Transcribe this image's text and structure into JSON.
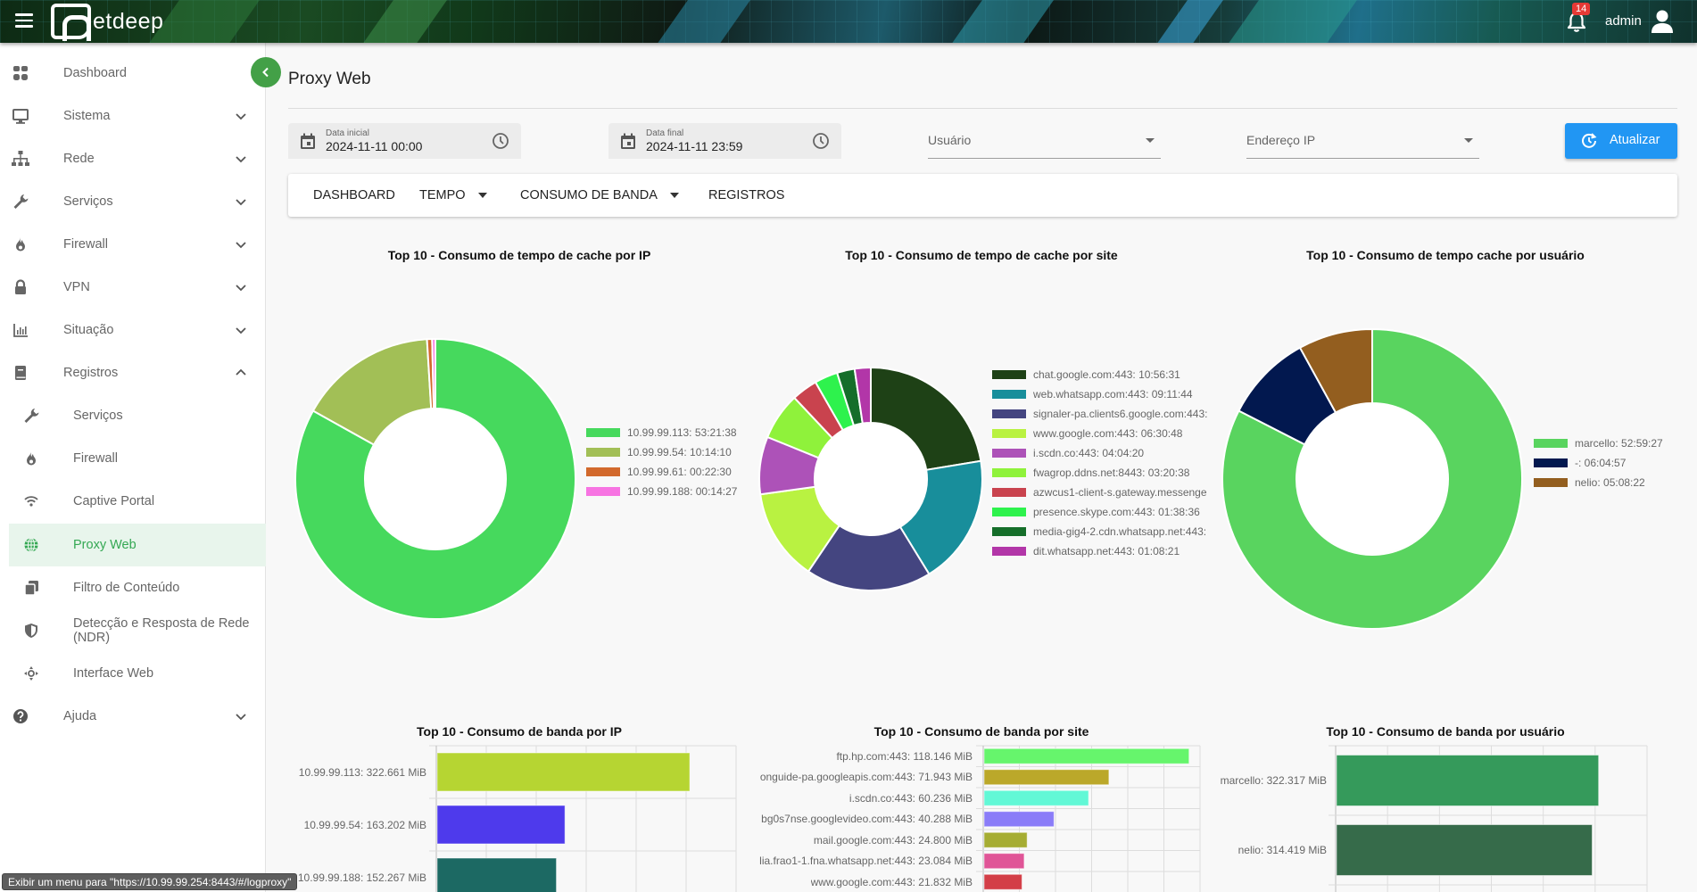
{
  "header": {
    "brand": "etdeep",
    "notification_count": "14",
    "username": "admin"
  },
  "sidebar": {
    "items": [
      {
        "label": "Dashboard",
        "icon": "dashboard-grid-icon"
      },
      {
        "label": "Sistema",
        "icon": "monitor-icon"
      },
      {
        "label": "Rede",
        "icon": "network-icon"
      },
      {
        "label": "Serviços",
        "icon": "wrench-icon"
      },
      {
        "label": "Firewall",
        "icon": "fire-icon"
      },
      {
        "label": "VPN",
        "icon": "lock-icon"
      },
      {
        "label": "Situação",
        "icon": "bar-chart-icon"
      },
      {
        "label": "Registros",
        "icon": "book-icon"
      }
    ],
    "sub_items": [
      {
        "label": "Serviços",
        "icon": "wrench-icon"
      },
      {
        "label": "Firewall",
        "icon": "fire-icon"
      },
      {
        "label": "Captive Portal",
        "icon": "wifi-icon"
      },
      {
        "label": "Proxy Web",
        "icon": "globe-icon",
        "active": true
      },
      {
        "label": "Filtro de Conteúdo",
        "icon": "copy-icon"
      },
      {
        "label": "Detecção e Resposta de Rede (NDR)",
        "icon": "shield-icon"
      },
      {
        "label": "Interface Web",
        "icon": "move-icon"
      }
    ],
    "help": {
      "label": "Ajuda",
      "icon": "help-icon"
    }
  },
  "page": {
    "title": "Proxy Web"
  },
  "filters": {
    "start_date": {
      "label": "Data inicial",
      "value": "2024-11-11 00:00"
    },
    "end_date": {
      "label": "Data final",
      "value": "2024-11-11 23:59"
    },
    "user_select": {
      "placeholder": "Usuário"
    },
    "ip_select": {
      "placeholder": "Endereço IP"
    },
    "refresh_label": "Atualizar"
  },
  "tabs": [
    {
      "label": "DASHBOARD"
    },
    {
      "label": "TEMPO",
      "dropdown": true
    },
    {
      "label": "CONSUMO DE BANDA",
      "dropdown": true
    },
    {
      "label": "REGISTROS"
    }
  ],
  "status_bar": {
    "text": "Exibir um menu para \"https://10.99.99.254:8443/#/logproxy\""
  },
  "chart_data": [
    {
      "type": "pie",
      "variant": "doughnut",
      "title": "Top 10 - Consumo de tempo de cache por IP",
      "legend_position": "right",
      "labels": [
        "10.99.99.113: 53:21:38",
        "10.99.99.54: 10:14:10",
        "10.99.99.61: 00:22:30",
        "10.99.99.188: 00:14:27"
      ],
      "categories": [
        "10.99.99.113",
        "10.99.99.54",
        "10.99.99.61",
        "10.99.99.188"
      ],
      "values_seconds": [
        192098,
        36850,
        1350,
        867
      ],
      "colors": [
        "#46d95d",
        "#a2bf56",
        "#d2692c",
        "#f774e2"
      ]
    },
    {
      "type": "pie",
      "variant": "doughnut",
      "title": "Top 10 - Consumo de tempo de cache por site",
      "legend_position": "right",
      "labels": [
        "chat.google.com:443: 10:56:31",
        "web.whatsapp.com:443: 09:11:44",
        "signaler-pa.clients6.google.com:443:",
        "www.google.com:443: 06:30:48",
        "i.scdn.co:443: 04:04:20",
        "fwagrop.ddns.net:8443: 03:20:38",
        "azwcus1-client-s.gateway.messenge",
        "presence.skype.com:443: 01:38:36",
        "media-gig4-2.cdn.whatsapp.net:443:",
        "dit.whatsapp.net:443: 01:08:21"
      ],
      "categories": [
        "chat.google.com:443",
        "web.whatsapp.com:443",
        "signaler-pa.clients6.google.com:443",
        "www.google.com:443",
        "i.scdn.co:443",
        "fwagrop.ddns.net:8443",
        "azwcus1-client-s.gateway.messenger",
        "presence.skype.com:443",
        "media-gig4-2.cdn.whatsapp.net:443",
        "dit.whatsapp.net:443"
      ],
      "values_seconds": [
        39391,
        33104,
        32000,
        23448,
        14660,
        12038,
        6600,
        5916,
        4500,
        4101
      ],
      "colors": [
        "#1e4116",
        "#188e9b",
        "#444580",
        "#b9f241",
        "#ad52b8",
        "#8ff23b",
        "#c9434e",
        "#2ef24d",
        "#156e2a",
        "#b236a8"
      ]
    },
    {
      "type": "pie",
      "variant": "doughnut",
      "title": "Top 10 - Consumo de tempo cache por usuário",
      "legend_position": "right",
      "labels": [
        "marcello: 52:59:27",
        "-: 06:04:57",
        "nelio: 05:08:22"
      ],
      "categories": [
        "marcello",
        "-",
        "nelio"
      ],
      "values_seconds": [
        190767,
        21897,
        18502
      ],
      "colors": [
        "#59d45f",
        "#02184f",
        "#935e1f"
      ]
    },
    {
      "type": "bar",
      "orientation": "horizontal",
      "title": "Top 10 - Consumo de banda por IP",
      "categories": [
        "10.99.99.113: 322.661 MiB",
        "10.99.99.54: 163.202 MiB",
        "10.99.99.188: 152.267 MiB"
      ],
      "values": [
        322.661,
        163.202,
        152.267
      ],
      "unit": "MiB",
      "xlim": [
        0,
        383
      ],
      "grid": true,
      "colors": [
        "#b6d532",
        "#4e3aec",
        "#1c6963"
      ]
    },
    {
      "type": "bar",
      "orientation": "horizontal",
      "title": "Top 10 - Consumo de banda por site",
      "categories": [
        "ftp.hp.com:443: 118.146 MiB",
        "onguide-pa.googleapis.com:443: 71.943 MiB",
        "i.scdn.co:443: 60.236 MiB",
        "bg0s7nse.googlevideo.com:443: 40.288 MiB",
        "mail.google.com:443: 24.800 MiB",
        "lia.frao1-1.fna.whatsapp.net:443: 23.084 MiB",
        "www.google.com:443: 21.832 MiB"
      ],
      "values": [
        118.146,
        71.943,
        60.236,
        40.288,
        24.8,
        23.084,
        21.832
      ],
      "unit": "MiB",
      "xlim": [
        0,
        125
      ],
      "grid": true,
      "colors": [
        "#66f56c",
        "#bba82a",
        "#62f8d6",
        "#8a7cf8",
        "#a6ad33",
        "#e05597",
        "#d33e47"
      ]
    },
    {
      "type": "bar",
      "orientation": "horizontal",
      "title": "Top 10 - Consumo de banda por usuário",
      "categories": [
        "marcello: 322.317 MiB",
        "nelio: 314.419 MiB"
      ],
      "values": [
        322.317,
        314.419
      ],
      "unit": "MiB",
      "xlim": [
        0,
        383
      ],
      "grid": true,
      "colors": [
        "#359a5b",
        "#366b4a"
      ]
    }
  ]
}
